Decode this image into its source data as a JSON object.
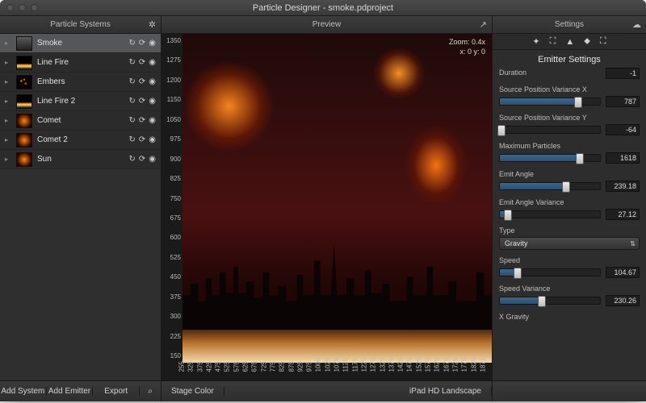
{
  "window": {
    "title": "Particle Designer - smoke.pdproject"
  },
  "panels": {
    "left_title": "Particle Systems",
    "mid_title": "Preview",
    "right_title": "Settings"
  },
  "systems": [
    {
      "name": "Smoke",
      "thumb": "smoke",
      "selected": true
    },
    {
      "name": "Line Fire",
      "thumb": "line",
      "selected": false
    },
    {
      "name": "Embers",
      "thumb": "embers",
      "selected": false
    },
    {
      "name": "Line Fire 2",
      "thumb": "line",
      "selected": false
    },
    {
      "name": "Comet",
      "thumb": "fire",
      "selected": false
    },
    {
      "name": "Comet 2",
      "thumb": "fire",
      "selected": false
    },
    {
      "name": "Sun",
      "thumb": "fire",
      "selected": false
    }
  ],
  "icons": {
    "replay": "↻",
    "refresh": "⟳",
    "eye": "◉",
    "gear": "✲",
    "share": "↗",
    "cloud": "☁",
    "search": "⌕",
    "tab1": "✦",
    "tab2": "⛶",
    "tab3": "▲",
    "tab4": "⬥",
    "tab5": "⛶"
  },
  "preview": {
    "zoom_label": "Zoom: 0.4x",
    "coord_label": "x: 0 y: 0",
    "ruler_y": [
      "1350",
      "1275",
      "1200",
      "1150",
      "1050",
      "975",
      "900",
      "825",
      "750",
      "675",
      "600",
      "525",
      "450",
      "375",
      "300",
      "225",
      "150"
    ],
    "ruler_x": [
      "255",
      "325",
      "375",
      "425",
      "475",
      "525",
      "575",
      "625",
      "675",
      "725",
      "775",
      "825",
      "875",
      "925",
      "975",
      "1000",
      "1025",
      "1075",
      "1125",
      "1175",
      "1225",
      "1275",
      "1325",
      "1375",
      "1425",
      "1475",
      "1525",
      "1575",
      "1625",
      "1675",
      "1725",
      "1775",
      "1825",
      "1871"
    ]
  },
  "settings": {
    "title": "Emitter Settings",
    "duration_label": "Duration",
    "duration_value": "-1",
    "fields": [
      {
        "label": "Source Position Variance X",
        "value": "787",
        "pct": 78
      },
      {
        "label": "Source Position Variance Y",
        "value": "-64",
        "pct": 2
      },
      {
        "label": "Maximum Particles",
        "value": "1618",
        "pct": 80
      },
      {
        "label": "Emit Angle",
        "value": "239.18",
        "pct": 66
      },
      {
        "label": "Emit Angle Variance",
        "value": "27.12",
        "pct": 8
      }
    ],
    "type_label": "Type",
    "type_value": "Gravity",
    "speed": [
      {
        "label": "Speed",
        "value": "104.67",
        "pct": 18
      },
      {
        "label": "Speed Variance",
        "value": "230.26",
        "pct": 42
      }
    ],
    "xgrav_label": "X Gravity"
  },
  "footer": {
    "add_system": "Add System",
    "add_emitter": "Add Emitter",
    "export": "Export",
    "stage_color": "Stage Color",
    "device": "iPad HD Landscape"
  }
}
